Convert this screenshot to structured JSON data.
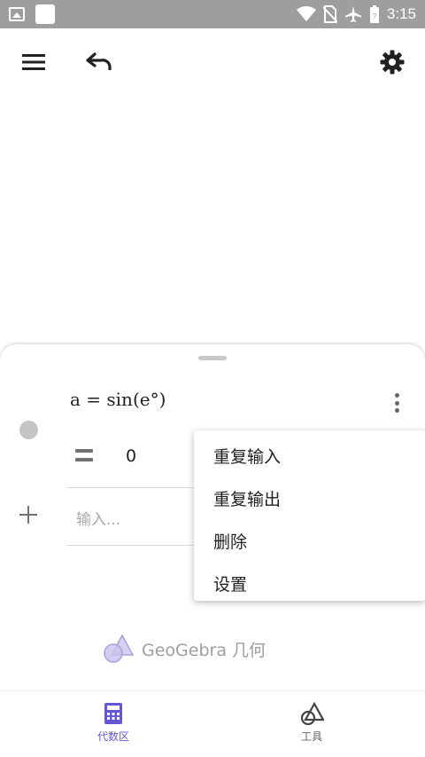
{
  "status_bar": {
    "time": "3:15",
    "icons": [
      "image-icon",
      "square-app-icon",
      "wifi-icon",
      "no-sim-icon",
      "airplane-icon",
      "battery-icon"
    ]
  },
  "toolbar": {
    "menu_icon": "menu-icon",
    "undo_icon": "undo-icon",
    "settings_icon": "settings-icon"
  },
  "algebra": {
    "expression": "a = sin(e°)",
    "output_value": "0",
    "input_placeholder": "输入..."
  },
  "context_menu": {
    "items": [
      "重复输入",
      "重复输出",
      "删除",
      "设置"
    ]
  },
  "brand": {
    "text": "GeoGebra 几何"
  },
  "bottom_nav": {
    "items": [
      {
        "label": "代数区",
        "icon": "calculator-icon",
        "active": true
      },
      {
        "label": "工具",
        "icon": "tools-icon",
        "active": false
      }
    ]
  },
  "colors": {
    "status_bar": "#9e9e9e",
    "accent": "#6557d2",
    "marble": "#c4c4c4"
  }
}
